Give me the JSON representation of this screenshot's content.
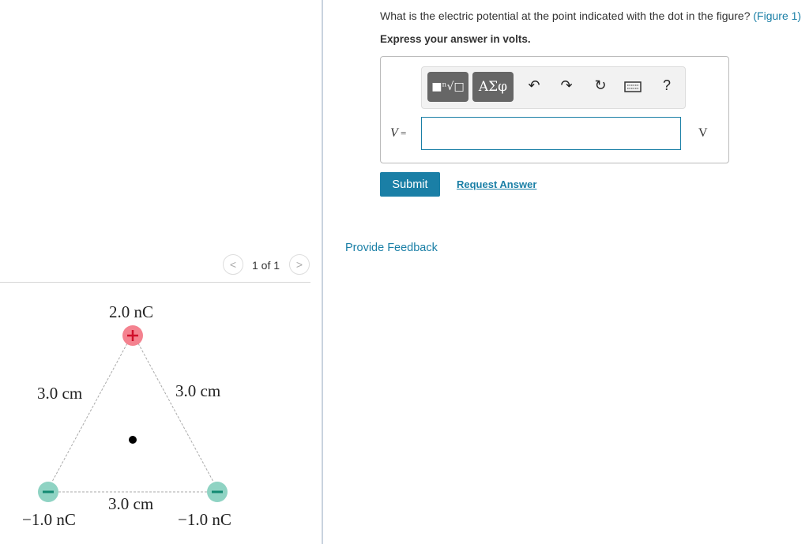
{
  "question": {
    "text": "What is the electric potential at the point indicated with the dot in the figure? ",
    "figure_link": "(Figure 1)",
    "instruction": "Express your answer in volts."
  },
  "toolbar": {
    "templates": "■ⁿ√□",
    "greek": "ΑΣφ",
    "undo": "undo-icon",
    "redo": "redo-icon",
    "reset": "reset-icon",
    "keyboard": "keyboard-icon",
    "help": "?"
  },
  "answer": {
    "label_var": "V",
    "label_eq": " =",
    "value": "",
    "unit": "V"
  },
  "buttons": {
    "submit": "Submit",
    "request": "Request Answer"
  },
  "feedback": "Provide Feedback",
  "pager": {
    "text": "1 of 1"
  },
  "figure": {
    "top_charge": "2.0 nC",
    "left_charge": "−1.0 nC",
    "right_charge": "−1.0 nC",
    "left_side": "3.0 cm",
    "right_side": "3.0 cm",
    "bottom_side": "3.0 cm",
    "colors": {
      "positive": "#f4828f",
      "negative": "#8fd3c3"
    }
  }
}
